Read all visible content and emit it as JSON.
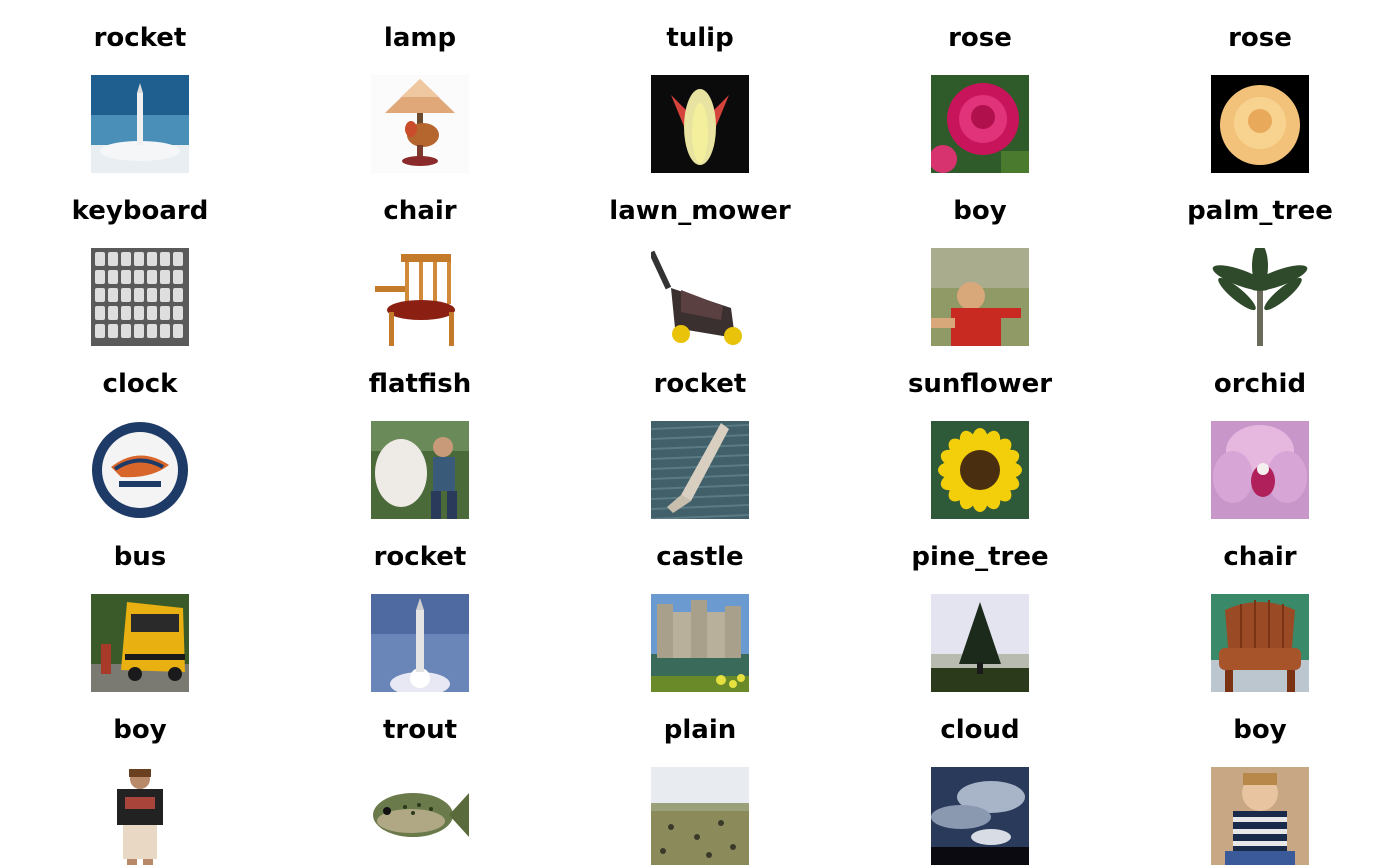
{
  "grid": {
    "rows": 5,
    "cols": 5,
    "items": [
      {
        "label": "rocket",
        "icon": "rocket-launch-thumbnail"
      },
      {
        "label": "lamp",
        "icon": "rooster-lamp-thumbnail"
      },
      {
        "label": "tulip",
        "icon": "tulip-thumbnail"
      },
      {
        "label": "rose",
        "icon": "pink-rose-thumbnail"
      },
      {
        "label": "rose",
        "icon": "yellow-rose-thumbnail"
      },
      {
        "label": "keyboard",
        "icon": "keyboard-thumbnail"
      },
      {
        "label": "chair",
        "icon": "wooden-chair-thumbnail"
      },
      {
        "label": "lawn_mower",
        "icon": "lawn-mower-thumbnail"
      },
      {
        "label": "boy",
        "icon": "boy-red-shirt-thumbnail"
      },
      {
        "label": "palm_tree",
        "icon": "palm-tree-thumbnail"
      },
      {
        "label": "clock",
        "icon": "wall-clock-thumbnail"
      },
      {
        "label": "flatfish",
        "icon": "flatfish-thumbnail"
      },
      {
        "label": "rocket",
        "icon": "rocket-water-thumbnail"
      },
      {
        "label": "sunflower",
        "icon": "sunflower-thumbnail"
      },
      {
        "label": "orchid",
        "icon": "orchid-thumbnail"
      },
      {
        "label": "bus",
        "icon": "school-bus-thumbnail"
      },
      {
        "label": "rocket",
        "icon": "rocket-blue-sky-thumbnail"
      },
      {
        "label": "castle",
        "icon": "castle-thumbnail"
      },
      {
        "label": "pine_tree",
        "icon": "pine-tree-thumbnail"
      },
      {
        "label": "chair",
        "icon": "leather-chair-thumbnail"
      },
      {
        "label": "boy",
        "icon": "boy-standing-thumbnail"
      },
      {
        "label": "trout",
        "icon": "trout-thumbnail"
      },
      {
        "label": "plain",
        "icon": "plain-thumbnail"
      },
      {
        "label": "cloud",
        "icon": "cloud-sky-thumbnail"
      },
      {
        "label": "boy",
        "icon": "boy-sitting-thumbnail"
      }
    ]
  }
}
